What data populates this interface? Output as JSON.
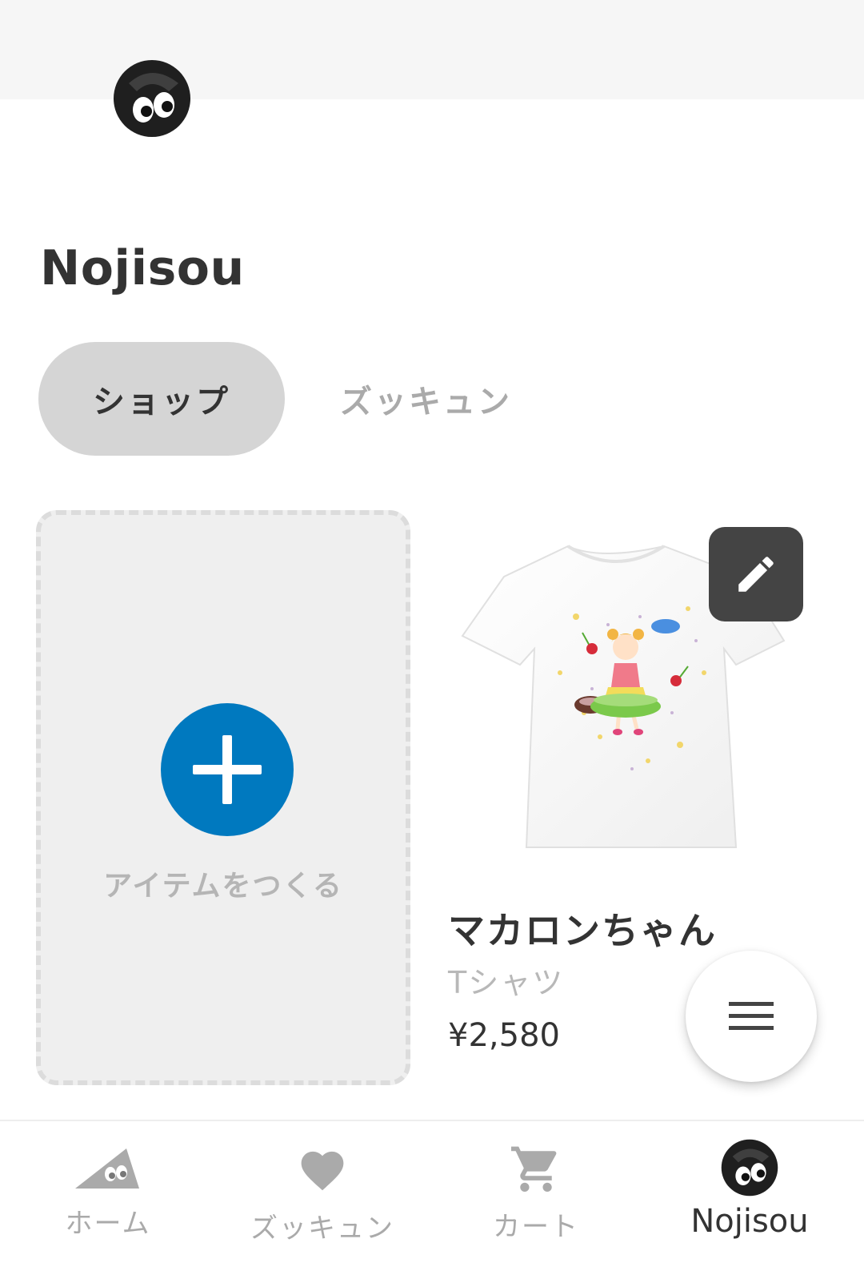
{
  "shop": {
    "name": "Nojisou"
  },
  "tabs": [
    {
      "label": "ショップ",
      "active": true
    },
    {
      "label": "ズッキュン",
      "active": false
    }
  ],
  "create_card": {
    "label": "アイテムをつくる",
    "accent_color": "#0079bf"
  },
  "product": {
    "name": "マカロンちゃん",
    "type": "Tシャツ",
    "price": "¥2,580"
  },
  "bottom_nav": {
    "items": [
      {
        "label": "ホーム",
        "icon": "home-icon",
        "active": false
      },
      {
        "label": "ズッキュン",
        "icon": "heart-icon",
        "active": false
      },
      {
        "label": "カート",
        "icon": "cart-icon",
        "active": false
      },
      {
        "label": "Nojisou",
        "icon": "avatar",
        "active": true
      }
    ]
  }
}
